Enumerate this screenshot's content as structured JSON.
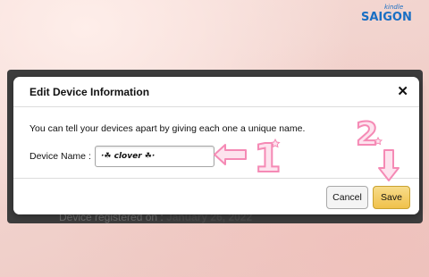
{
  "colors": {
    "overlay": "#3d3d3d",
    "accent_pink": "#f7a6c4",
    "save_yellow": "#f0c14b",
    "logo_blue": "#1a6fc4"
  },
  "background": {
    "registered_label": "Device registered on : ",
    "registered_date": "January 26, 2022"
  },
  "dialog": {
    "title": "Edit Device Information",
    "close_label": "✕",
    "description": "You can tell your devices apart by giving each one a unique name.",
    "field_label": "Device Name :",
    "field_value": "·☘ clover ☘·",
    "cancel_label": "Cancel",
    "save_label": "Save"
  },
  "annotations": {
    "step1": "1",
    "step2": "2"
  },
  "logo": {
    "main": "SAIGON",
    "sub": "kindle"
  }
}
